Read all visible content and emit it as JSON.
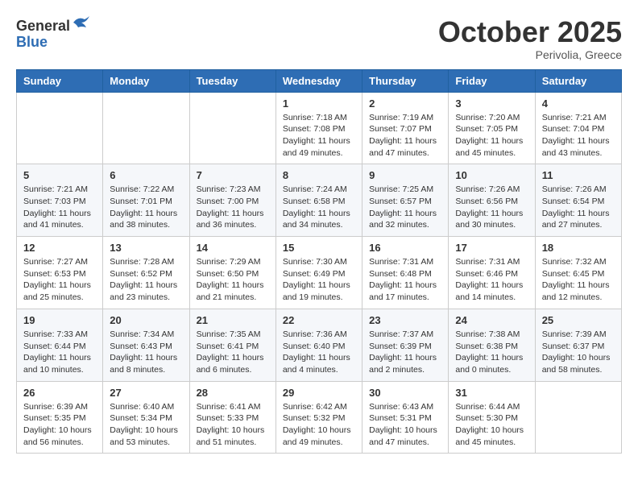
{
  "header": {
    "logo_line1": "General",
    "logo_line2": "Blue",
    "month_title": "October 2025",
    "location": "Perivolia, Greece"
  },
  "weekdays": [
    "Sunday",
    "Monday",
    "Tuesday",
    "Wednesday",
    "Thursday",
    "Friday",
    "Saturday"
  ],
  "weeks": [
    [
      {
        "day": "",
        "sunrise": "",
        "sunset": "",
        "daylight": ""
      },
      {
        "day": "",
        "sunrise": "",
        "sunset": "",
        "daylight": ""
      },
      {
        "day": "",
        "sunrise": "",
        "sunset": "",
        "daylight": ""
      },
      {
        "day": "1",
        "sunrise": "Sunrise: 7:18 AM",
        "sunset": "Sunset: 7:08 PM",
        "daylight": "Daylight: 11 hours and 49 minutes."
      },
      {
        "day": "2",
        "sunrise": "Sunrise: 7:19 AM",
        "sunset": "Sunset: 7:07 PM",
        "daylight": "Daylight: 11 hours and 47 minutes."
      },
      {
        "day": "3",
        "sunrise": "Sunrise: 7:20 AM",
        "sunset": "Sunset: 7:05 PM",
        "daylight": "Daylight: 11 hours and 45 minutes."
      },
      {
        "day": "4",
        "sunrise": "Sunrise: 7:21 AM",
        "sunset": "Sunset: 7:04 PM",
        "daylight": "Daylight: 11 hours and 43 minutes."
      }
    ],
    [
      {
        "day": "5",
        "sunrise": "Sunrise: 7:21 AM",
        "sunset": "Sunset: 7:03 PM",
        "daylight": "Daylight: 11 hours and 41 minutes."
      },
      {
        "day": "6",
        "sunrise": "Sunrise: 7:22 AM",
        "sunset": "Sunset: 7:01 PM",
        "daylight": "Daylight: 11 hours and 38 minutes."
      },
      {
        "day": "7",
        "sunrise": "Sunrise: 7:23 AM",
        "sunset": "Sunset: 7:00 PM",
        "daylight": "Daylight: 11 hours and 36 minutes."
      },
      {
        "day": "8",
        "sunrise": "Sunrise: 7:24 AM",
        "sunset": "Sunset: 6:58 PM",
        "daylight": "Daylight: 11 hours and 34 minutes."
      },
      {
        "day": "9",
        "sunrise": "Sunrise: 7:25 AM",
        "sunset": "Sunset: 6:57 PM",
        "daylight": "Daylight: 11 hours and 32 minutes."
      },
      {
        "day": "10",
        "sunrise": "Sunrise: 7:26 AM",
        "sunset": "Sunset: 6:56 PM",
        "daylight": "Daylight: 11 hours and 30 minutes."
      },
      {
        "day": "11",
        "sunrise": "Sunrise: 7:26 AM",
        "sunset": "Sunset: 6:54 PM",
        "daylight": "Daylight: 11 hours and 27 minutes."
      }
    ],
    [
      {
        "day": "12",
        "sunrise": "Sunrise: 7:27 AM",
        "sunset": "Sunset: 6:53 PM",
        "daylight": "Daylight: 11 hours and 25 minutes."
      },
      {
        "day": "13",
        "sunrise": "Sunrise: 7:28 AM",
        "sunset": "Sunset: 6:52 PM",
        "daylight": "Daylight: 11 hours and 23 minutes."
      },
      {
        "day": "14",
        "sunrise": "Sunrise: 7:29 AM",
        "sunset": "Sunset: 6:50 PM",
        "daylight": "Daylight: 11 hours and 21 minutes."
      },
      {
        "day": "15",
        "sunrise": "Sunrise: 7:30 AM",
        "sunset": "Sunset: 6:49 PM",
        "daylight": "Daylight: 11 hours and 19 minutes."
      },
      {
        "day": "16",
        "sunrise": "Sunrise: 7:31 AM",
        "sunset": "Sunset: 6:48 PM",
        "daylight": "Daylight: 11 hours and 17 minutes."
      },
      {
        "day": "17",
        "sunrise": "Sunrise: 7:31 AM",
        "sunset": "Sunset: 6:46 PM",
        "daylight": "Daylight: 11 hours and 14 minutes."
      },
      {
        "day": "18",
        "sunrise": "Sunrise: 7:32 AM",
        "sunset": "Sunset: 6:45 PM",
        "daylight": "Daylight: 11 hours and 12 minutes."
      }
    ],
    [
      {
        "day": "19",
        "sunrise": "Sunrise: 7:33 AM",
        "sunset": "Sunset: 6:44 PM",
        "daylight": "Daylight: 11 hours and 10 minutes."
      },
      {
        "day": "20",
        "sunrise": "Sunrise: 7:34 AM",
        "sunset": "Sunset: 6:43 PM",
        "daylight": "Daylight: 11 hours and 8 minutes."
      },
      {
        "day": "21",
        "sunrise": "Sunrise: 7:35 AM",
        "sunset": "Sunset: 6:41 PM",
        "daylight": "Daylight: 11 hours and 6 minutes."
      },
      {
        "day": "22",
        "sunrise": "Sunrise: 7:36 AM",
        "sunset": "Sunset: 6:40 PM",
        "daylight": "Daylight: 11 hours and 4 minutes."
      },
      {
        "day": "23",
        "sunrise": "Sunrise: 7:37 AM",
        "sunset": "Sunset: 6:39 PM",
        "daylight": "Daylight: 11 hours and 2 minutes."
      },
      {
        "day": "24",
        "sunrise": "Sunrise: 7:38 AM",
        "sunset": "Sunset: 6:38 PM",
        "daylight": "Daylight: 11 hours and 0 minutes."
      },
      {
        "day": "25",
        "sunrise": "Sunrise: 7:39 AM",
        "sunset": "Sunset: 6:37 PM",
        "daylight": "Daylight: 10 hours and 58 minutes."
      }
    ],
    [
      {
        "day": "26",
        "sunrise": "Sunrise: 6:39 AM",
        "sunset": "Sunset: 5:35 PM",
        "daylight": "Daylight: 10 hours and 56 minutes."
      },
      {
        "day": "27",
        "sunrise": "Sunrise: 6:40 AM",
        "sunset": "Sunset: 5:34 PM",
        "daylight": "Daylight: 10 hours and 53 minutes."
      },
      {
        "day": "28",
        "sunrise": "Sunrise: 6:41 AM",
        "sunset": "Sunset: 5:33 PM",
        "daylight": "Daylight: 10 hours and 51 minutes."
      },
      {
        "day": "29",
        "sunrise": "Sunrise: 6:42 AM",
        "sunset": "Sunset: 5:32 PM",
        "daylight": "Daylight: 10 hours and 49 minutes."
      },
      {
        "day": "30",
        "sunrise": "Sunrise: 6:43 AM",
        "sunset": "Sunset: 5:31 PM",
        "daylight": "Daylight: 10 hours and 47 minutes."
      },
      {
        "day": "31",
        "sunrise": "Sunrise: 6:44 AM",
        "sunset": "Sunset: 5:30 PM",
        "daylight": "Daylight: 10 hours and 45 minutes."
      },
      {
        "day": "",
        "sunrise": "",
        "sunset": "",
        "daylight": ""
      }
    ]
  ]
}
